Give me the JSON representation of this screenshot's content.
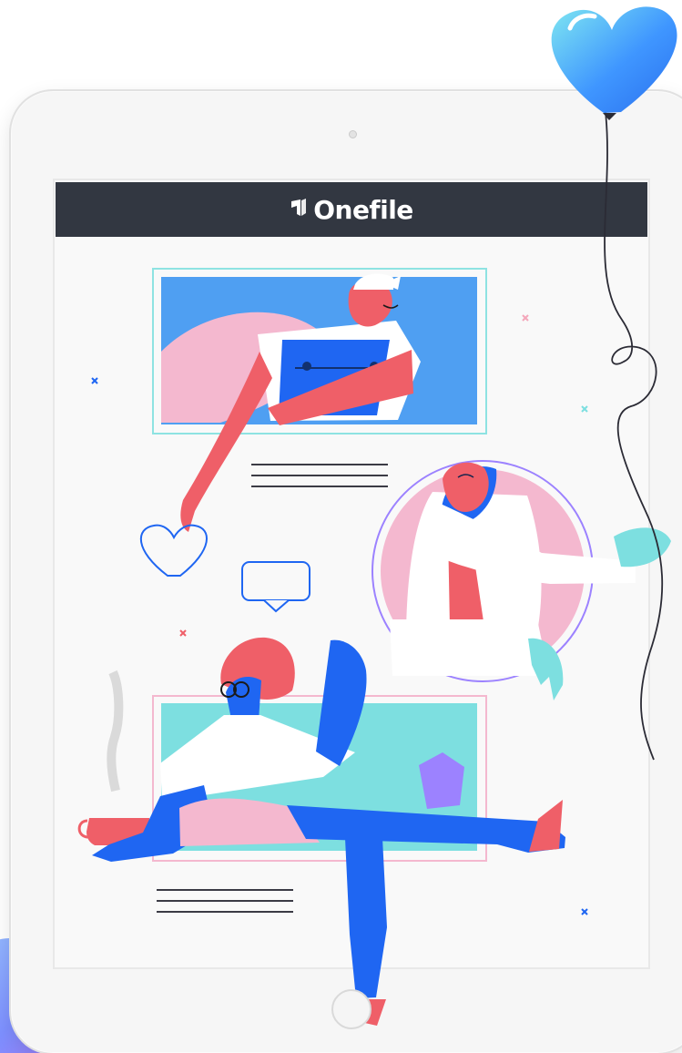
{
  "header": {
    "brand_name": "Onefile",
    "background_color": "#323741"
  },
  "icons": {
    "brand_logo": "onefile-logo-icon",
    "balloon": "heart-balloon-icon",
    "like": "heart-outline-icon",
    "comment": "speech-bubble-icon"
  },
  "colors": {
    "accent_blue": "#1f66f2",
    "sky_blue": "#4f9ff2",
    "teal": "#7ddfe0",
    "pink": "#f4b8cf",
    "coral": "#ef5f68",
    "purple": "#9c82ff",
    "line": "#3b3b45"
  }
}
